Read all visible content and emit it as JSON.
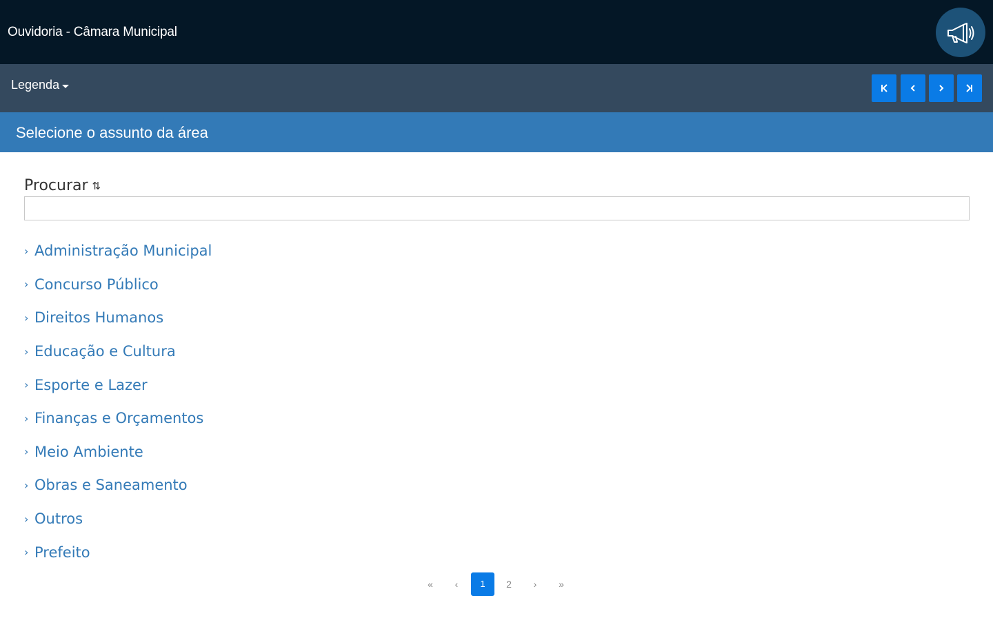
{
  "header": {
    "title": "Ouvidoria - Câmara Municipal",
    "action_icon": "megaphone-icon"
  },
  "toolbar": {
    "legend_label": "Legenda",
    "nav_buttons": [
      {
        "icon": "first-page-icon",
        "glyph": "⏮"
      },
      {
        "icon": "previous-icon",
        "glyph": "‹"
      },
      {
        "icon": "next-icon",
        "glyph": "›"
      },
      {
        "icon": "last-page-icon",
        "glyph": "⏭"
      }
    ]
  },
  "section": {
    "title": "Selecione o assunto da área"
  },
  "search": {
    "label": "Procurar",
    "sort_icon": "⇅",
    "value": "",
    "placeholder": ""
  },
  "topics": [
    "Administração Municipal",
    "Concurso Público",
    "Direitos Humanos",
    "Educação e Cultura",
    "Esporte e Lazer",
    "Finanças e Orçamentos",
    "Meio Ambiente",
    "Obras e Saneamento",
    "Outros",
    "Prefeito"
  ],
  "pagination": {
    "first": "«",
    "prev": "‹",
    "pages": [
      "1",
      "2"
    ],
    "current_page": "1",
    "next": "›",
    "last": "»"
  },
  "colors": {
    "topbar": "#041726",
    "toolbar": "#34495e",
    "section": "#337ab7",
    "accent": "#0a7be6",
    "link": "#337ab7"
  }
}
